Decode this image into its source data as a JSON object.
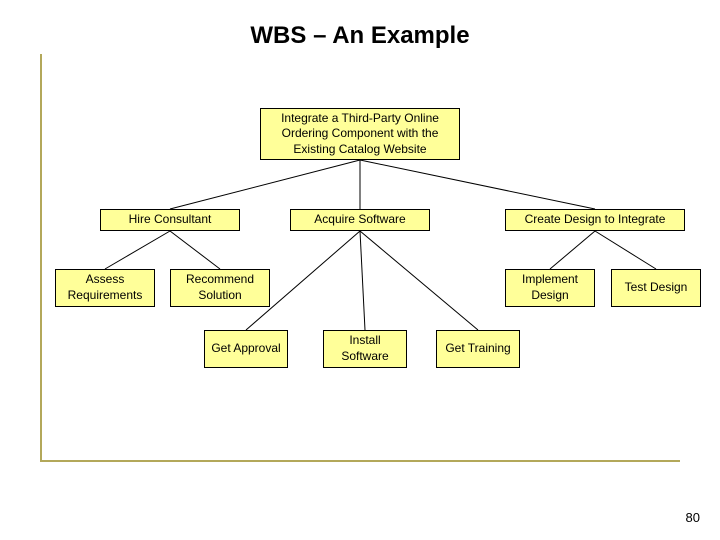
{
  "title": "WBS – An Example",
  "pageNumber": "80",
  "root": "Integrate a Third-Party Online Ordering Component with the Existing Catalog Website",
  "level1": {
    "hire": "Hire Consultant",
    "acquire": "Acquire Software",
    "create": "Create Design to Integrate"
  },
  "level2_hire": {
    "assess": "Assess Requirements",
    "recommend": "Recommend Solution"
  },
  "level2_create": {
    "implement": "Implement Design",
    "test": "Test Design"
  },
  "level2_acquire": {
    "approval": "Get Approval",
    "install": "Install Software",
    "training": "Get Training"
  }
}
